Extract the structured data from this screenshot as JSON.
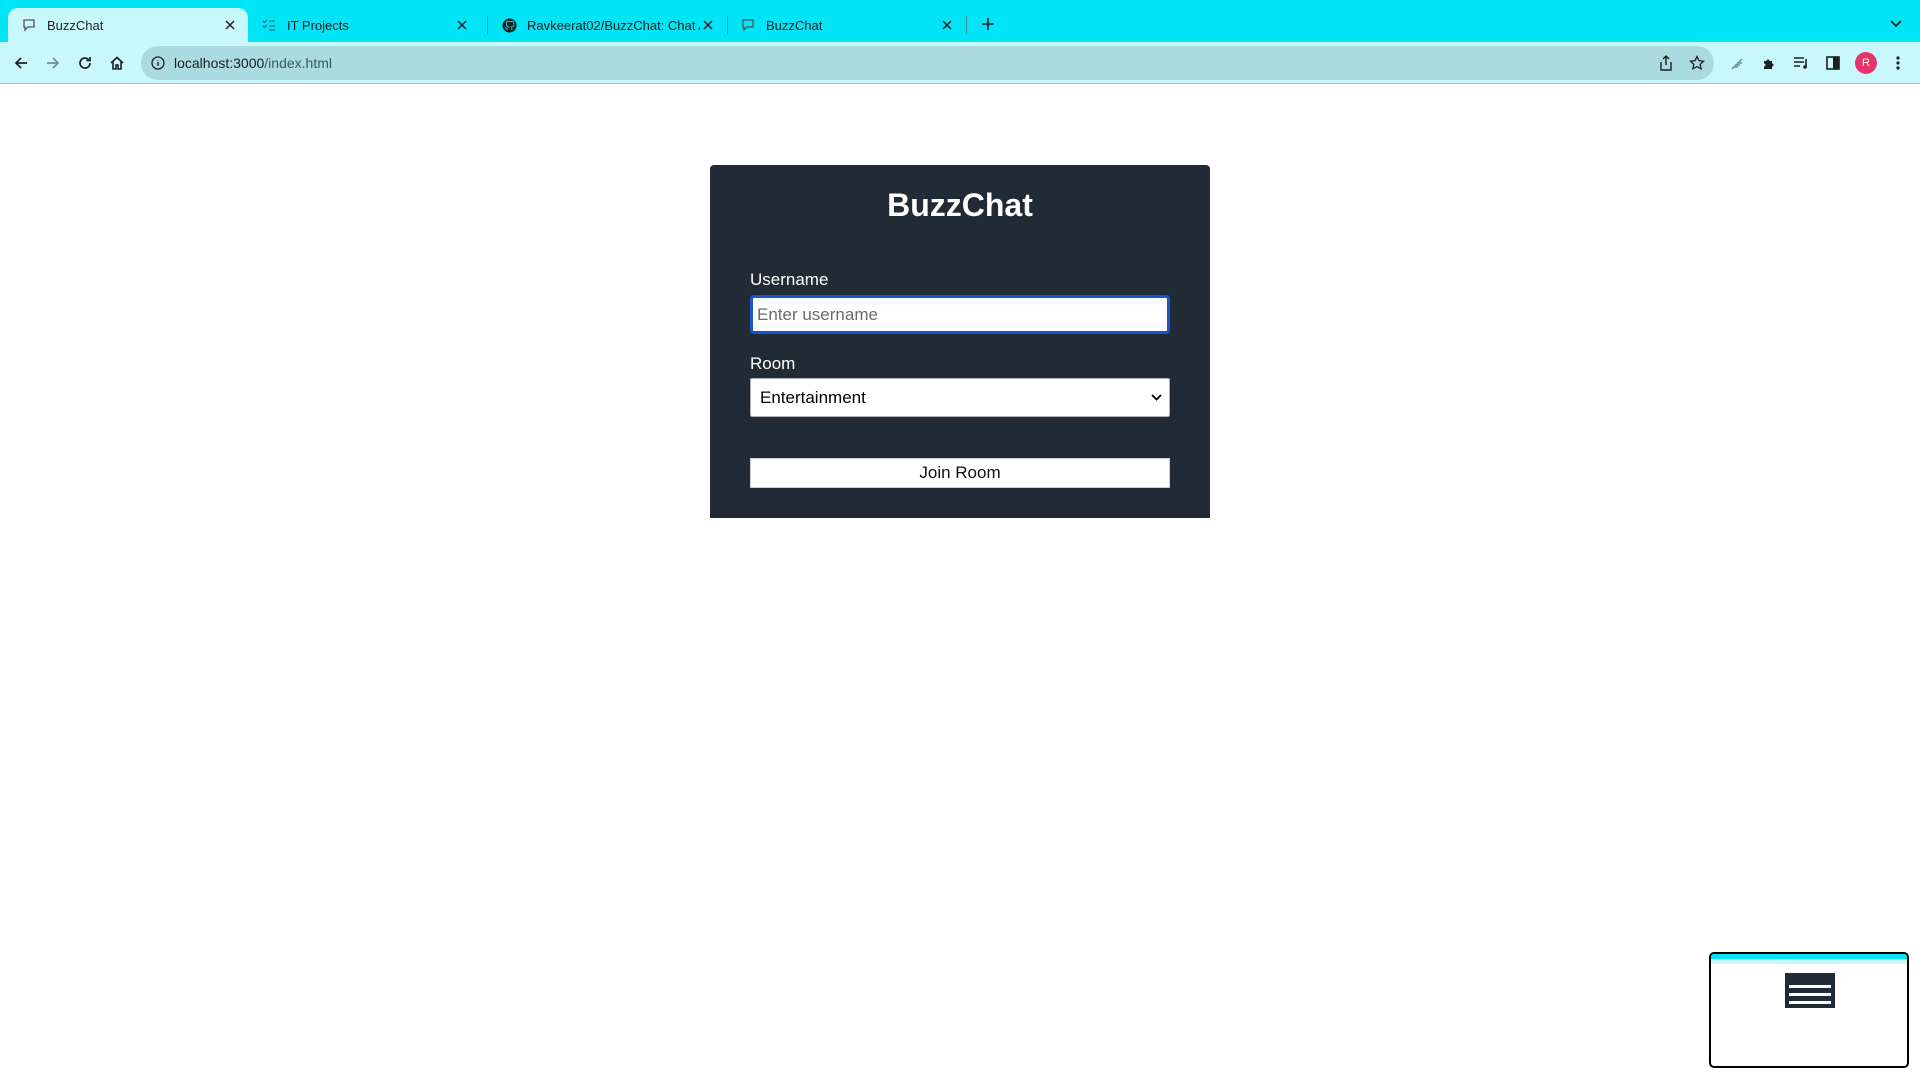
{
  "browser": {
    "tabs": [
      {
        "title": "BuzzChat",
        "favicon": "chat-bubble-icon",
        "active": true
      },
      {
        "title": "IT Projects",
        "favicon": "checklist-icon",
        "active": false
      },
      {
        "title": "Ravkeerat02/BuzzChat: Chat A",
        "favicon": "github-icon",
        "active": false
      },
      {
        "title": "BuzzChat",
        "favicon": "chat-bubble-icon",
        "active": false
      }
    ],
    "url_host": "localhost:3000",
    "url_path": "/index.html",
    "avatar_initial": "R"
  },
  "form": {
    "title": "BuzzChat",
    "username_label": "Username",
    "username_placeholder": "Enter username",
    "username_value": "",
    "room_label": "Room",
    "room_selected": "Entertainment",
    "submit_label": "Join Room"
  },
  "colors": {
    "tabstrip": "#00e5f5",
    "toolbar": "#c9f8fc",
    "card": "#212b35",
    "focus_ring": "#1a56c9",
    "avatar": "#e8346b"
  }
}
